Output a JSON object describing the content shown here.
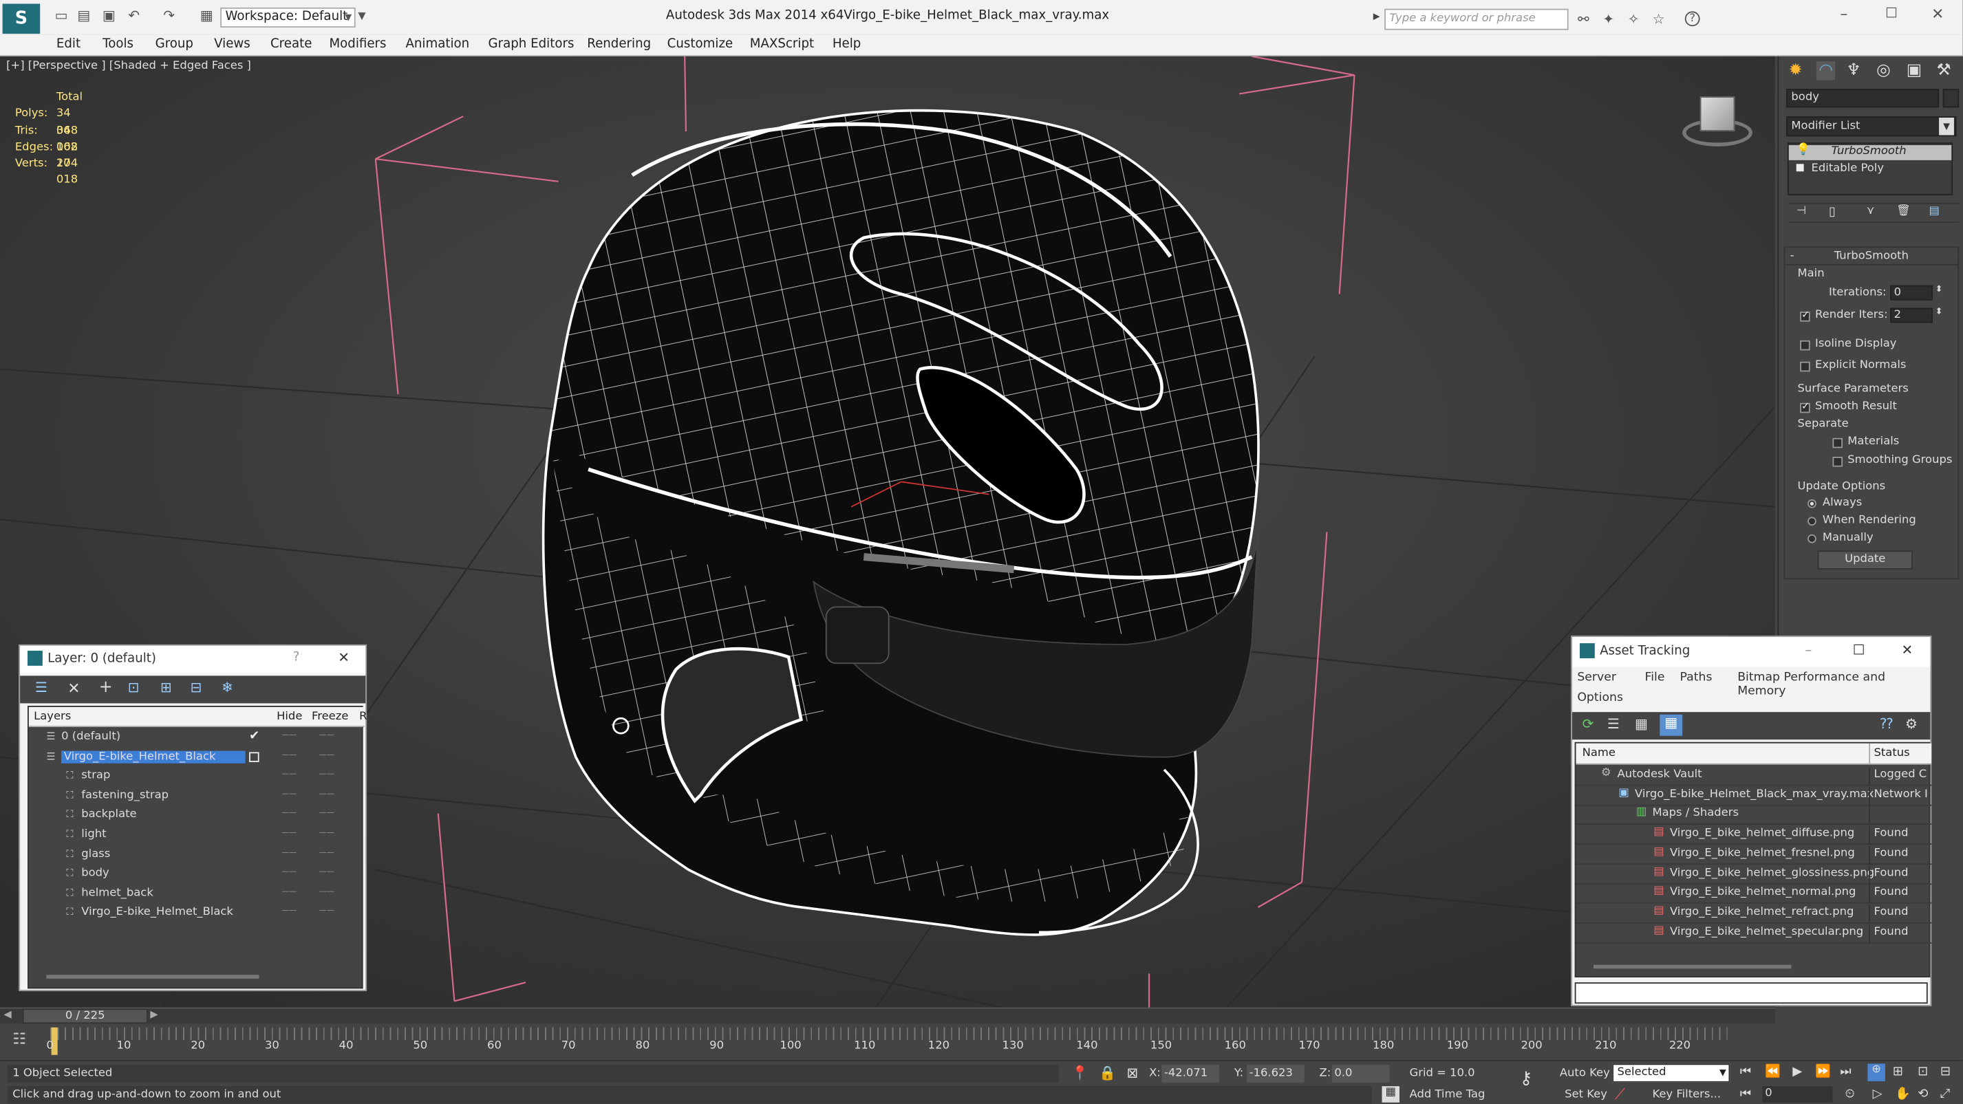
{
  "title_bar": {
    "workspace": "Workspace: Default",
    "app_name": "Autodesk 3ds Max  2014 x64",
    "file_name": "Virgo_E-bike_Helmet_Black_max_vray.max",
    "search_placeholder": "Type a keyword or phrase"
  },
  "menu": [
    "Edit",
    "Tools",
    "Group",
    "Views",
    "Create",
    "Modifiers",
    "Animation",
    "Graph Editors",
    "Rendering",
    "Customize",
    "MAXScript",
    "Help"
  ],
  "viewport": {
    "label": "[+] [Perspective ] [Shaded + Edged Faces ]",
    "stats": {
      "header": "Total",
      "rows": [
        {
          "label": "Polys:",
          "value": "34 068"
        },
        {
          "label": "Tris:",
          "value": "34 068"
        },
        {
          "label": "Edges:",
          "value": "102 204"
        },
        {
          "label": "Verts:",
          "value": "17 018"
        }
      ]
    }
  },
  "command_panel": {
    "object_name": "body",
    "modifier_list": "Modifier List",
    "stack": [
      "TurboSmooth",
      "Editable Poly"
    ],
    "rollout_title": "TurboSmooth",
    "main_label": "Main",
    "iterations_label": "Iterations:",
    "iterations_value": "0",
    "render_iters_label": "Render Iters:",
    "render_iters_value": "2",
    "isoline": "Isoline Display",
    "explicit_normals": "Explicit Normals",
    "surface_params": "Surface Parameters",
    "smooth_result": "Smooth Result",
    "separate": "Separate",
    "materials": "Materials",
    "smoothing_groups": "Smoothing Groups",
    "update_options": "Update Options",
    "always": "Always",
    "when_rendering": "When Rendering",
    "manually": "Manually",
    "update_button": "Update"
  },
  "layer_dialog": {
    "title": "Layer: 0 (default)",
    "help": "?",
    "col_layers": "Layers",
    "col_hide": "Hide",
    "col_freeze": "Freeze",
    "col_r": "R",
    "rows": [
      {
        "name": "0 (default)",
        "indent": 0,
        "selected": false
      },
      {
        "name": "Virgo_E-bike_Helmet_Black",
        "indent": 0,
        "selected": true
      },
      {
        "name": "strap",
        "indent": 1,
        "selected": false
      },
      {
        "name": "fastening_strap",
        "indent": 1,
        "selected": false
      },
      {
        "name": "backplate",
        "indent": 1,
        "selected": false
      },
      {
        "name": "light",
        "indent": 1,
        "selected": false
      },
      {
        "name": "glass",
        "indent": 1,
        "selected": false
      },
      {
        "name": "body",
        "indent": 1,
        "selected": false
      },
      {
        "name": "helmet_back",
        "indent": 1,
        "selected": false
      },
      {
        "name": "Virgo_E-bike_Helmet_Black",
        "indent": 1,
        "selected": false
      }
    ]
  },
  "asset_dialog": {
    "title": "Asset Tracking",
    "menu": [
      "Server",
      "File",
      "Paths",
      "Bitmap Performance and Memory"
    ],
    "menu2": "Options",
    "col_name": "Name",
    "col_status": "Status",
    "rows": [
      {
        "name": "Autodesk Vault",
        "status": "Logged C",
        "indent": 0
      },
      {
        "name": "Virgo_E-bike_Helmet_Black_max_vray.max",
        "status": "Network I",
        "indent": 1
      },
      {
        "name": "Maps / Shaders",
        "status": "",
        "indent": 2
      },
      {
        "name": "Virgo_E_bike_helmet_diffuse.png",
        "status": "Found",
        "indent": 3
      },
      {
        "name": "Virgo_E_bike_helmet_fresnel.png",
        "status": "Found",
        "indent": 3
      },
      {
        "name": "Virgo_E_bike_helmet_glossiness.png",
        "status": "Found",
        "indent": 3
      },
      {
        "name": "Virgo_E_bike_helmet_normal.png",
        "status": "Found",
        "indent": 3
      },
      {
        "name": "Virgo_E_bike_helmet_refract.png",
        "status": "Found",
        "indent": 3
      },
      {
        "name": "Virgo_E_bike_helmet_specular.png",
        "status": "Found",
        "indent": 3
      }
    ]
  },
  "timeline": {
    "frame_counter": "0 / 225",
    "ticks": [
      "0",
      "10",
      "20",
      "30",
      "40",
      "50",
      "60",
      "70",
      "80",
      "90",
      "100",
      "110",
      "120",
      "130",
      "140",
      "150",
      "160",
      "170",
      "180",
      "190",
      "200",
      "210",
      "220"
    ]
  },
  "status": {
    "selected": "1 Object Selected",
    "prompt": "Click and drag up-and-down to zoom in and out",
    "x_label": "X:",
    "x_value": "-42.071",
    "y_label": "Y:",
    "y_value": "-16.623",
    "z_label": "Z:",
    "z_value": "0.0",
    "grid": "Grid = 10.0",
    "auto_key": "Auto Key",
    "set_key": "Set Key",
    "key_mode": "Selected",
    "key_filters": "Key Filters...",
    "add_time_tag": "Add Time Tag",
    "frame_value": "0"
  }
}
